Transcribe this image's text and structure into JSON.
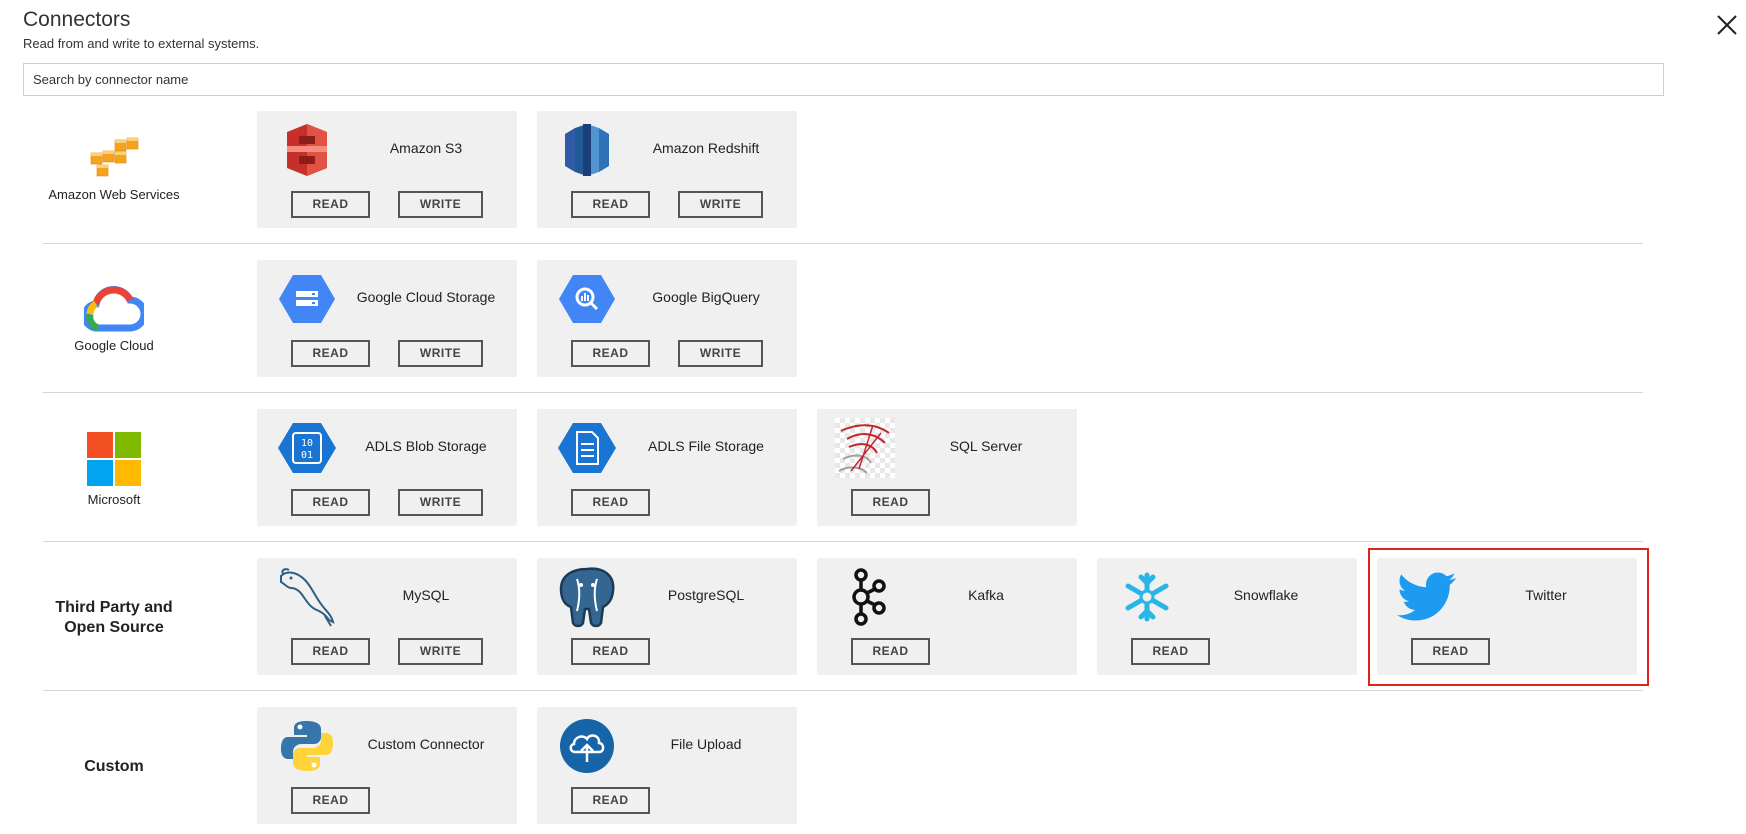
{
  "header": {
    "title": "Connectors",
    "subtitle": "Read from and write to external systems."
  },
  "search": {
    "placeholder": "Search by connector name"
  },
  "buttons": {
    "read": "READ",
    "write": "WRITE"
  },
  "sections": [
    {
      "provider": "Amazon Web Services",
      "provider_icon": "aws-cubes-icon",
      "connectors": [
        {
          "name": "Amazon S3",
          "icon": "amazon-s3-icon",
          "actions": [
            "READ",
            "WRITE"
          ]
        },
        {
          "name": "Amazon Redshift",
          "icon": "amazon-redshift-icon",
          "actions": [
            "READ",
            "WRITE"
          ]
        }
      ]
    },
    {
      "provider": "Google Cloud",
      "provider_icon": "google-cloud-icon",
      "connectors": [
        {
          "name": "Google Cloud Storage",
          "icon": "google-cloud-storage-icon",
          "actions": [
            "READ",
            "WRITE"
          ]
        },
        {
          "name": "Google BigQuery",
          "icon": "google-bigquery-icon",
          "actions": [
            "READ",
            "WRITE"
          ]
        }
      ]
    },
    {
      "provider": "Microsoft",
      "provider_icon": "microsoft-icon",
      "connectors": [
        {
          "name": "ADLS Blob Storage",
          "icon": "adls-blob-icon",
          "actions": [
            "READ",
            "WRITE"
          ]
        },
        {
          "name": "ADLS File Storage",
          "icon": "adls-file-icon",
          "actions": [
            "READ"
          ]
        },
        {
          "name": "SQL Server",
          "icon": "sql-server-icon",
          "actions": [
            "READ"
          ]
        }
      ]
    },
    {
      "provider": "Third Party and Open Source",
      "connectors": [
        {
          "name": "MySQL",
          "icon": "mysql-dolphin-icon",
          "actions": [
            "READ",
            "WRITE"
          ]
        },
        {
          "name": "PostgreSQL",
          "icon": "postgresql-elephant-icon",
          "actions": [
            "READ"
          ]
        },
        {
          "name": "Kafka",
          "icon": "kafka-icon",
          "actions": [
            "READ"
          ]
        },
        {
          "name": "Snowflake",
          "icon": "snowflake-icon",
          "actions": [
            "READ"
          ]
        },
        {
          "name": "Twitter",
          "icon": "twitter-bird-icon",
          "actions": [
            "READ"
          ],
          "highlighted": true
        }
      ]
    },
    {
      "provider": "Custom",
      "connectors": [
        {
          "name": "Custom Connector",
          "icon": "python-icon",
          "actions": [
            "READ"
          ]
        },
        {
          "name": "File Upload",
          "icon": "cloud-upload-icon",
          "actions": [
            "READ"
          ]
        }
      ]
    }
  ],
  "colors": {
    "highlight": "#e0231b",
    "card_bg": "#f0f0f0"
  }
}
